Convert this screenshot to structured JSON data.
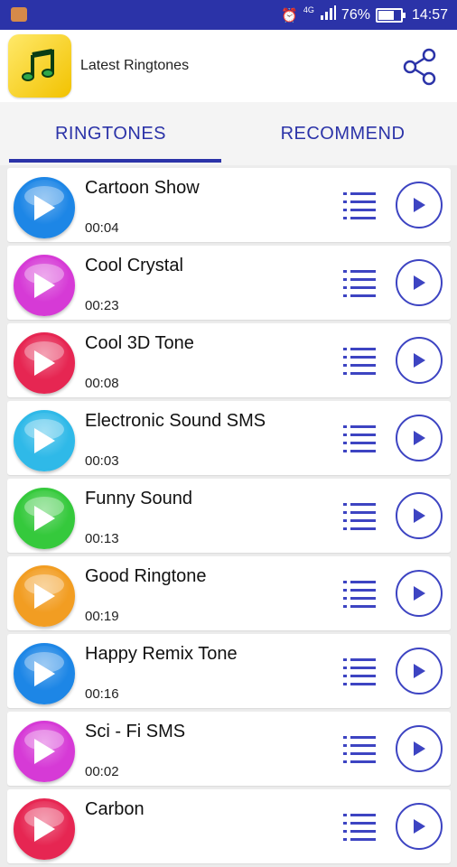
{
  "status": {
    "battery": "76%",
    "battery_level": 0.76,
    "time": "14:57",
    "network": "4G"
  },
  "app": {
    "title": "Latest Ringtones"
  },
  "tabs": [
    {
      "label": "RINGTONES",
      "active": true
    },
    {
      "label": "RECOMMEND",
      "active": false
    }
  ],
  "ringtones": [
    {
      "title": "Cartoon Show",
      "duration": "00:04",
      "color": "#1d86e6"
    },
    {
      "title": "Cool Crystal",
      "duration": "00:23",
      "color": "#d63ad6"
    },
    {
      "title": "Cool 3D Tone",
      "duration": "00:08",
      "color": "#e62652"
    },
    {
      "title": "Electronic Sound SMS",
      "duration": "00:03",
      "color": "#2fb9e8"
    },
    {
      "title": "Funny Sound",
      "duration": "00:13",
      "color": "#35c93c"
    },
    {
      "title": "Good Ringtone",
      "duration": "00:19",
      "color": "#f29d22"
    },
    {
      "title": "Happy Remix Tone",
      "duration": "00:16",
      "color": "#1d86e6"
    },
    {
      "title": "Sci - Fi SMS",
      "duration": "00:02",
      "color": "#d63ad6"
    },
    {
      "title": "Carbon",
      "duration": "",
      "color": "#e62652"
    }
  ],
  "colors": {
    "primary": "#2b33a8",
    "icon": "#3d44c2"
  }
}
